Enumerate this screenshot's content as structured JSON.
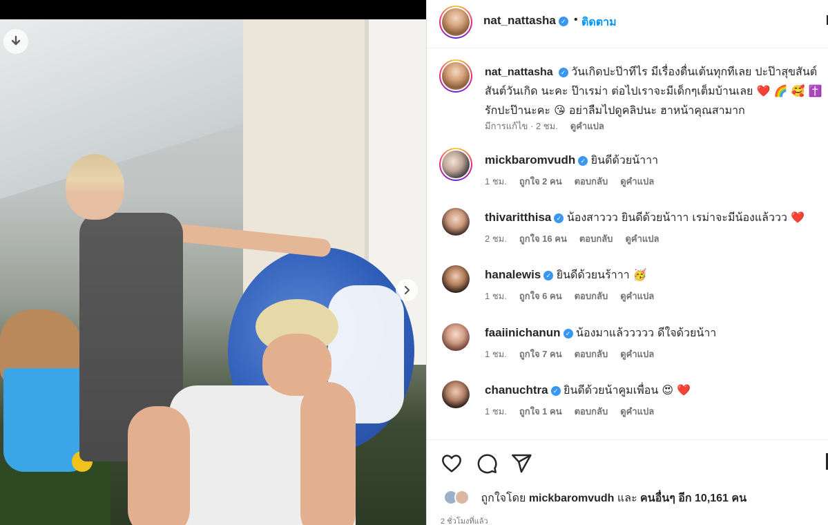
{
  "post": {
    "author": "nat_nattasha",
    "follow_label": "ติดตาม",
    "dot": "•",
    "caption": "วันเกิดปะป๊าทีไร มีเรื่องตื่นเต้นทุกทีเลย ปะป๊าสุขสันต์สันต์วันเกิด นะคะ ป๊าเรม่า ต่อไปเราจะมีเด็กๆเต็มบ้านเลย ❤️ 🌈 🥰 ✝️ รักปะป๊านะคะ 😘 อย่าลืมไปดูคลิปนะ ฮาหน้าคุณสามาก",
    "edited": "มีการแก้ไข · 2 ชม.",
    "translate": "ดูคำแปล"
  },
  "comments": [
    {
      "user": "mickbaromvudh",
      "text": "ยินดีด้วยน้าาา",
      "time": "1 ชม.",
      "likes": "ถูกใจ 2 คน",
      "reply": "ตอบกลับ",
      "translate": "ดูคำแปล"
    },
    {
      "user": "thivaritthisa",
      "text": "น้องสาววว ยินดีด้วยน้าาา เรม่าจะมีน้องแล้ววว ❤️",
      "time": "2 ชม.",
      "likes": "ถูกใจ 16 คน",
      "reply": "ตอบกลับ",
      "translate": "ดูคำแปล"
    },
    {
      "user": "hanalewis",
      "text": "ยินดีด้วยนร้าาา 🥳",
      "time": "1 ชม.",
      "likes": "ถูกใจ 6 คน",
      "reply": "ตอบกลับ",
      "translate": "ดูคำแปล"
    },
    {
      "user": "faaiinichanun",
      "text": "น้องมาแล้ววววว ดีใจด้วยน้าา",
      "time": "1 ชม.",
      "likes": "ถูกใจ 7 คน",
      "reply": "ตอบกลับ",
      "translate": "ดูคำแปล"
    },
    {
      "user": "chanuchtra",
      "text": "ยินดีด้วยน้าคูมเพื่อน 😍 ❤️",
      "time": "1 ชม.",
      "likes": "ถูกใจ 1 คน",
      "reply": "ตอบกลับ",
      "translate": "ดูคำแปล"
    }
  ],
  "likes_line": {
    "prefix": "ถูกใจโดย",
    "user": "mickbaromvudh",
    "conj": "และ",
    "others": "คนอื่นๆ อีก 10,161 คน"
  },
  "posted_time": "2 ชั่วโมงที่แล้ว",
  "icons": {
    "download": "download-icon",
    "next": "chevron-right-icon",
    "like": "heart-icon",
    "comment": "comment-icon",
    "share": "share-icon",
    "verified": "verified-badge-icon"
  },
  "colors": {
    "link": "#0095f6",
    "verified": "#3897f0",
    "muted": "#737373"
  }
}
